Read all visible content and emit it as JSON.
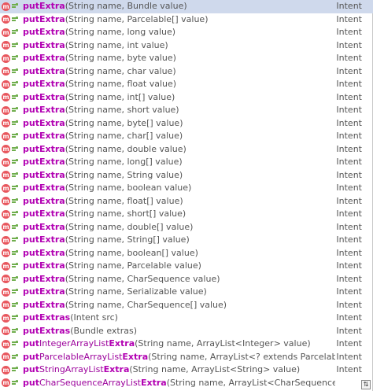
{
  "rows": [
    {
      "prefix": "putExtra",
      "middle": "",
      "suffix": "",
      "params": "(String name, Bundle value)",
      "type": "Intent"
    },
    {
      "prefix": "putExtra",
      "middle": "",
      "suffix": "",
      "params": "(String name, Parcelable[] value)",
      "type": "Intent"
    },
    {
      "prefix": "putExtra",
      "middle": "",
      "suffix": "",
      "params": "(String name, long value)",
      "type": "Intent"
    },
    {
      "prefix": "putExtra",
      "middle": "",
      "suffix": "",
      "params": "(String name, int value)",
      "type": "Intent"
    },
    {
      "prefix": "putExtra",
      "middle": "",
      "suffix": "",
      "params": "(String name, byte value)",
      "type": "Intent"
    },
    {
      "prefix": "putExtra",
      "middle": "",
      "suffix": "",
      "params": "(String name, char value)",
      "type": "Intent"
    },
    {
      "prefix": "putExtra",
      "middle": "",
      "suffix": "",
      "params": "(String name, float value)",
      "type": "Intent"
    },
    {
      "prefix": "putExtra",
      "middle": "",
      "suffix": "",
      "params": "(String name, int[] value)",
      "type": "Intent"
    },
    {
      "prefix": "putExtra",
      "middle": "",
      "suffix": "",
      "params": "(String name, short value)",
      "type": "Intent"
    },
    {
      "prefix": "putExtra",
      "middle": "",
      "suffix": "",
      "params": "(String name, byte[] value)",
      "type": "Intent"
    },
    {
      "prefix": "putExtra",
      "middle": "",
      "suffix": "",
      "params": "(String name, char[] value)",
      "type": "Intent"
    },
    {
      "prefix": "putExtra",
      "middle": "",
      "suffix": "",
      "params": "(String name, double value)",
      "type": "Intent"
    },
    {
      "prefix": "putExtra",
      "middle": "",
      "suffix": "",
      "params": "(String name, long[] value)",
      "type": "Intent"
    },
    {
      "prefix": "putExtra",
      "middle": "",
      "suffix": "",
      "params": "(String name, String value)",
      "type": "Intent"
    },
    {
      "prefix": "putExtra",
      "middle": "",
      "suffix": "",
      "params": "(String name, boolean value)",
      "type": "Intent"
    },
    {
      "prefix": "putExtra",
      "middle": "",
      "suffix": "",
      "params": "(String name, float[] value)",
      "type": "Intent"
    },
    {
      "prefix": "putExtra",
      "middle": "",
      "suffix": "",
      "params": "(String name, short[] value)",
      "type": "Intent"
    },
    {
      "prefix": "putExtra",
      "middle": "",
      "suffix": "",
      "params": "(String name, double[] value)",
      "type": "Intent"
    },
    {
      "prefix": "putExtra",
      "middle": "",
      "suffix": "",
      "params": "(String name, String[] value)",
      "type": "Intent"
    },
    {
      "prefix": "putExtra",
      "middle": "",
      "suffix": "",
      "params": "(String name, boolean[] value)",
      "type": "Intent"
    },
    {
      "prefix": "putExtra",
      "middle": "",
      "suffix": "",
      "params": "(String name, Parcelable value)",
      "type": "Intent"
    },
    {
      "prefix": "putExtra",
      "middle": "",
      "suffix": "",
      "params": "(String name, CharSequence value)",
      "type": "Intent"
    },
    {
      "prefix": "putExtra",
      "middle": "",
      "suffix": "",
      "params": "(String name, Serializable value)",
      "type": "Intent"
    },
    {
      "prefix": "putExtra",
      "middle": "",
      "suffix": "",
      "params": "(String name, CharSequence[] value)",
      "type": "Intent"
    },
    {
      "prefix": "putExtras",
      "middle": "",
      "suffix": "",
      "params": "(Intent src)",
      "type": "Intent"
    },
    {
      "prefix": "putExtras",
      "middle": "",
      "suffix": "",
      "params": "(Bundle extras)",
      "type": "Intent"
    },
    {
      "prefix": "put",
      "middle": "IntegerArrayList",
      "suffix": "Extra",
      "params": "(String name, ArrayList<Integer> value)",
      "type": "Intent"
    },
    {
      "prefix": "put",
      "middle": "ParcelableArrayList",
      "suffix": "Extra",
      "params": "(String name, ArrayList<? extends Parcelable> val...",
      "type": "Intent"
    },
    {
      "prefix": "put",
      "middle": "StringArrayList",
      "suffix": "Extra",
      "params": "(String name, ArrayList<String> value)",
      "type": "Intent"
    },
    {
      "prefix": "put",
      "middle": "CharSequenceArrayList",
      "suffix": "Extra",
      "params": "(String name, ArrayList<CharSequence> value)",
      "type": ""
    }
  ],
  "icons": {
    "method": "m",
    "visibility": "public-method-icon"
  },
  "corner_glyph": "⇅",
  "colors": {
    "selection": "#cfd9ec",
    "match_highlight": "#b200b2",
    "method_icon": "#e8565d"
  }
}
